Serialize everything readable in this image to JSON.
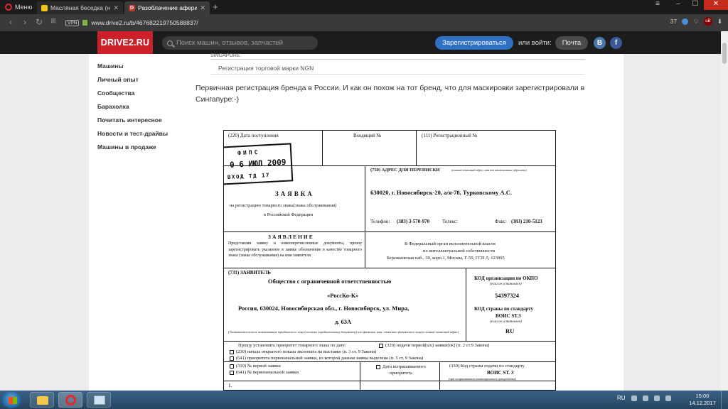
{
  "browser": {
    "menu_label": "Меню",
    "tabs": [
      {
        "title": "Масляная беседка (не пы"
      },
      {
        "title": "Разоблачение аферисті"
      }
    ],
    "new_tab": "+",
    "vpn": "VPN",
    "url": "www.drive2.ru/b/467682219750588837/",
    "adblock_count": "37"
  },
  "site": {
    "logo": "DRIVE2.RU",
    "search_placeholder": "Поиск машин, отзывов, запчастей",
    "register_button": "Зарегистрироваться",
    "login_text": "или войти:",
    "mail_button": "Почта",
    "vk": "В",
    "fb": "f"
  },
  "sidebar": {
    "items": [
      {
        "label": "Машины"
      },
      {
        "label": "Личный опыт"
      },
      {
        "label": "Сообщества"
      },
      {
        "label": "Барахолка"
      },
      {
        "label": "Почитать интересное"
      },
      {
        "label": "Новости и тест-драйвы"
      },
      {
        "label": "Машины в продаже"
      }
    ]
  },
  "post": {
    "prev_caption": "SINGAPORE",
    "prev_title": "Регистрация торговой марки NGN",
    "text": "Первичная регистрация бренда в России. И как он похож на тот бренд, что для маскировки зарегистрировали в Сингапуре:-)"
  },
  "document": {
    "f220": "(220) Дата поступления",
    "incoming": "Входящий №",
    "f111": "(111) Регистрационный №",
    "stamp_org": "ФИПС",
    "stamp_date": "0 6 ИЮЛ 2009",
    "stamp_dept": "ВХОД  ТД 17",
    "title": "ЗАЯВКА",
    "subtitle": "на регистрацию товарного знака(знака обслуживания)",
    "subtitle2": "в Российской Федерации",
    "f750": "(750) АДРЕС ДЛЯ ПЕРЕПИСКИ",
    "f750_note": "(полный почтовый адрес, имя или наименование адресата)",
    "address": "630020, г. Новосибирск-20, а/я-78, Турковскому А.С.",
    "phone_label": "Телефон:",
    "phone": "(383) 3-570-970",
    "telex_label": "Телекс:",
    "fax_label": "Факс:",
    "fax": "(383) 210-5123",
    "statement_title": "ЗАЯВЛЕНИЕ",
    "statement_text": "Представляя заявку и нижеперечисленные документы, прошу зарегистрировать указанное в заявке обозначение в качестве товарного знака (знака обслуживания) на имя заявителя",
    "organ_line1": "В Федеральный орган исполнительной власти",
    "organ_line2": "по интеллектуальной собственности",
    "organ_line3": "Бережковская наб., 30, корп.1, Москва, Г-59, ГСП-5, 123995",
    "f731": "(731) ЗАЯВИТЕЛЬ",
    "applicant1": "Общество с ограниченной ответственностью",
    "applicant2": "«РоссКо-К»",
    "applicant3": "Россия, 630024, Новосибирская обл., г. Новосибирск, ул. Мира,",
    "applicant4": "д. 63А",
    "applicant_note": "(Указывается полное наименование юридического лица (согласно учредительному документу) или фамилия, имя, отчество физического лица и полный почтовый адрес)",
    "okpo_title": "КОД организации по ОКПО",
    "okpo_note": "(если он установлен)",
    "okpo": "54397324",
    "country_title": "КОД страны по стандарту",
    "country_std": "ВОИС ST.3",
    "country_note": "(если он установлен)",
    "country": "RU",
    "priority_title": "Прошу установить приоритет товарного знака по дате:",
    "p320": "(320) подачи первой(ых) заявки(ок) (п. 2 ст.9 Закона)",
    "p230": "(230) начала открытого показа экспоната на выставке (п. 3 ст. 9 Закона)",
    "p641": "(641) приоритета первоначальной заявки, из которой данная заявка выделена (п. 5 ст. 9 Закона)",
    "p310": "(310) № первой заявки",
    "p641b": "(641) № первоначальной заявки",
    "pdate": "Дата испрашиваемого приоритета",
    "p330": "(330) Код страны подачи по стандарту",
    "p330b": "ВОИС ST. 3",
    "p330note": "(при испрашивании конвенционного приоритета)",
    "row_num": "1."
  },
  "taskbar": {
    "lang": "RU",
    "time": "15:00",
    "date": "14.12.2017"
  }
}
